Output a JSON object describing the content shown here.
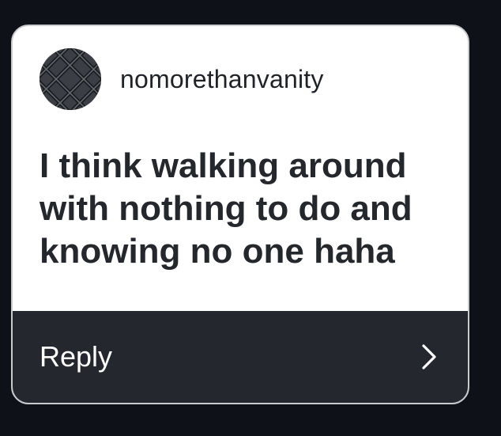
{
  "post": {
    "avatar_icon": "profile-picture",
    "username": "nomorethanvanity",
    "message": "I think walking around with nothing to do and knowing no one haha"
  },
  "reply": {
    "label": "Reply",
    "icon": "chevron-right-icon"
  },
  "colors": {
    "page_background": "#0e1117",
    "card_background": "#ffffff",
    "reply_bar_background": "#24272d",
    "text_dark": "#24272c",
    "text_light": "#ffffff"
  }
}
